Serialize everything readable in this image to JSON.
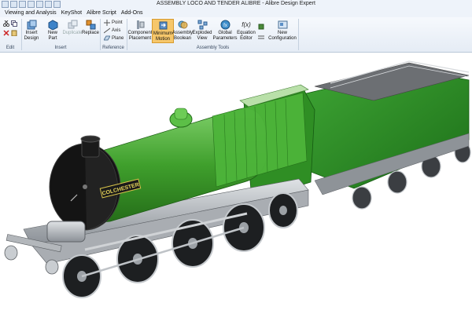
{
  "window": {
    "title": "ASSEMBLY LOCO AND TENDER ALIBRE - Alibre Design Expert"
  },
  "menu": {
    "items": [
      "Viewing and Analysis",
      "KeyShot",
      "Alibre Script",
      "Add-Ons"
    ]
  },
  "ribbon": {
    "insert": {
      "insert_design": "Insert Design",
      "new_part": "New Part",
      "duplicate": "Duplicate",
      "replace": "Replace"
    },
    "reference": {
      "point": "Point",
      "axis": "Axis",
      "plane": "Plane"
    },
    "assembly_tools": {
      "component_placement": "Component Placement",
      "minimum_motion": "Minimum Motion",
      "assembly_boolean": "Assembly Boolean",
      "exploded_view": "Exploded View",
      "global_parameters": "Global Parameters",
      "equation_editor": "Equation Editor",
      "new_configuration": "New Configuration",
      "fx_glyph": "f(x)"
    },
    "groups": {
      "edit": "Edit",
      "insert": "Insert",
      "reference": "Reference",
      "assembly_tools": "Assembly Tools"
    }
  },
  "model": {
    "nameplate": "COLCHESTER",
    "colors": {
      "body_green": "#3f9f2c",
      "dark_green": "#2a7d1f",
      "smokebox": "#141414",
      "chassis_grey": "#b9bdc1"
    }
  }
}
